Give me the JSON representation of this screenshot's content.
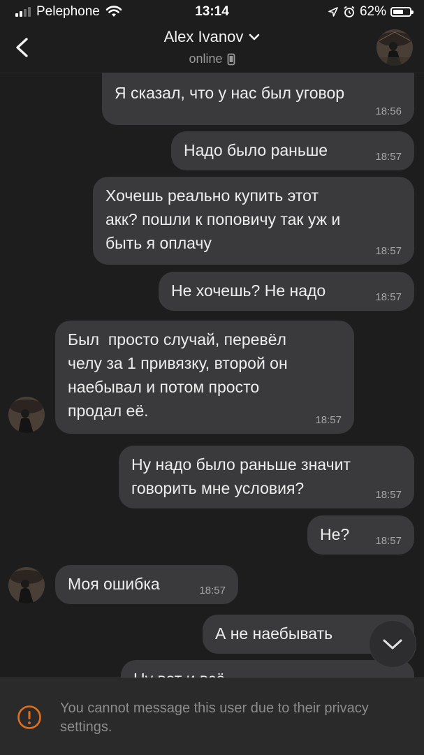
{
  "status_bar": {
    "carrier": "Pelephone",
    "time": "13:14",
    "battery_percent": "62%",
    "battery_level": 0.62,
    "signal_bars": 4,
    "signal_active": 2
  },
  "header": {
    "contact_name": "Alex Ivanov",
    "status": "online",
    "icons": [
      "back-arrow-icon",
      "chevron-down-icon",
      "phone-device-icon",
      "avatar"
    ]
  },
  "messages": [
    {
      "side": "out",
      "text": "Я сказал, что у нас был уговор",
      "time": "18:56"
    },
    {
      "side": "out",
      "text": "Надо было раньше",
      "time": "18:57"
    },
    {
      "side": "out",
      "text": "Хочешь реально купить этот\nакк? пошли к поповичу так уж и\nбыть я оплачу",
      "time": "18:57"
    },
    {
      "side": "out",
      "text": "Не хочешь? Не надо",
      "time": "18:57"
    },
    {
      "side": "in",
      "text": "Был  просто случай, перевёл\nчелу за 1 привязку, второй он\nнаебывал и потом просто\nпродал её.",
      "time": "18:57"
    },
    {
      "side": "out",
      "text": "Ну надо было раньше значит\nговорить мне условия?",
      "time": "18:57"
    },
    {
      "side": "out",
      "text": "Не?",
      "time": "18:57"
    },
    {
      "side": "in",
      "text": "Моя ошибка",
      "time": "18:57"
    },
    {
      "side": "out",
      "text": "А не наебывать",
      "time": ""
    },
    {
      "side": "out",
      "text": "Ну вот и всё",
      "time": ""
    }
  ],
  "notice": {
    "text": "You cannot message this user due to their privacy settings.",
    "icon": "warning-circle-icon",
    "accent": "#e0701b"
  },
  "colors": {
    "background": "#1d1d1d",
    "bubble": "#3a3a3c",
    "text": "#ededed",
    "timestamp": "#a6a6a6"
  }
}
